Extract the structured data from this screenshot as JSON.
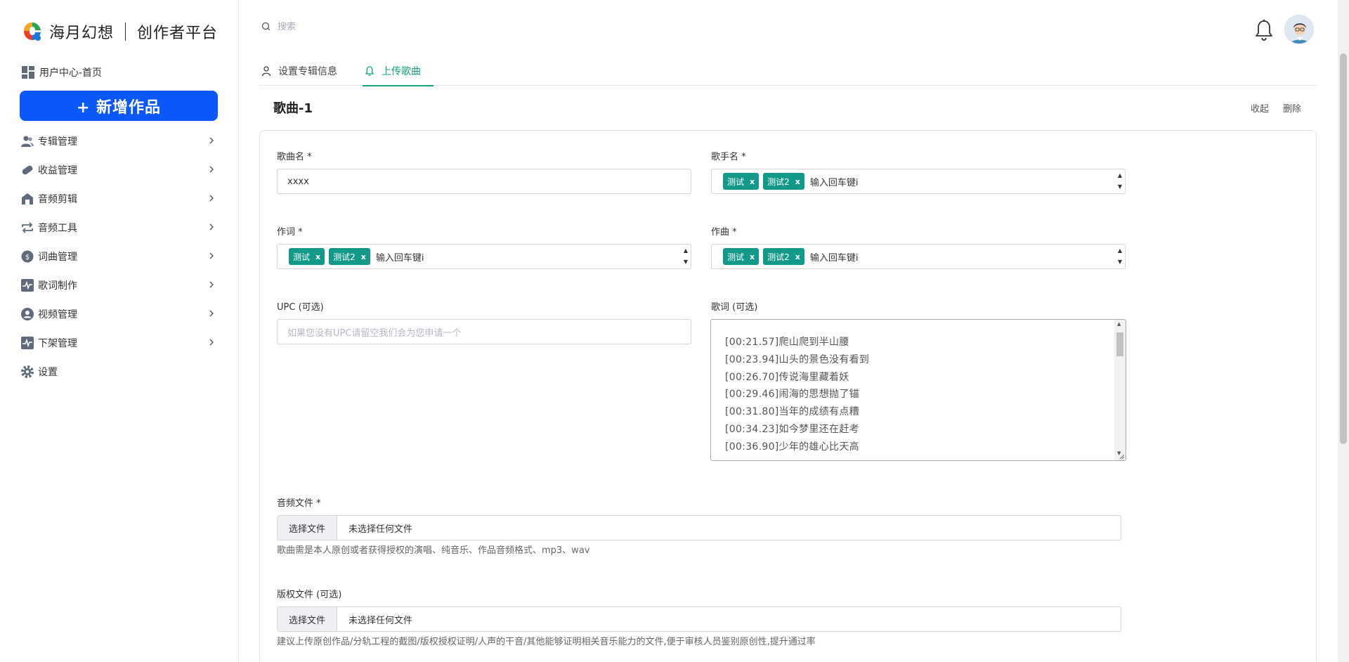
{
  "brand": {
    "name": "海月幻想",
    "subtitle": "创作者平台"
  },
  "sidebar": {
    "home_label": "用户中心-首页",
    "new_button_label": "+ 新增作品",
    "items": [
      {
        "label": "专辑管理",
        "icon": "users-icon"
      },
      {
        "label": "收益管理",
        "icon": "pill-icon"
      },
      {
        "label": "音频剪辑",
        "icon": "store-icon"
      },
      {
        "label": "音频工具",
        "icon": "repeat-icon"
      },
      {
        "label": "词曲管理",
        "icon": "dollar-circle-icon"
      },
      {
        "label": "歌词制作",
        "icon": "activity-icon"
      },
      {
        "label": "视频管理",
        "icon": "user-circle-icon"
      },
      {
        "label": "下架管理",
        "icon": "activity-icon"
      },
      {
        "label": "设置",
        "icon": "gear-icon"
      }
    ]
  },
  "header": {
    "search_placeholder": "搜索"
  },
  "tabs": [
    {
      "label": "设置专辑信息",
      "active": false,
      "icon": "user-icon"
    },
    {
      "label": "上传歌曲",
      "active": true,
      "icon": "bell-icon"
    }
  ],
  "song": {
    "title": "歌曲-1",
    "collapse_label": "收起",
    "delete_label": "删除"
  },
  "form": {
    "song_name_label": "歌曲名 *",
    "song_name_value": "xxxx",
    "singer_label": "歌手名 *",
    "singer_tags": [
      "测试",
      "测试2"
    ],
    "singer_placeholder": "输入回车键i",
    "lyricist_label": "作词 *",
    "lyricist_tags": [
      "测试",
      "测试2"
    ],
    "lyricist_placeholder": "输入回车键i",
    "composer_label": "作曲 *",
    "composer_tags": [
      "测试",
      "测试2"
    ],
    "composer_placeholder": "输入回车键i",
    "upc_label": "UPC (可选)",
    "upc_placeholder": "如果您没有UPC请留空我们会为您申请一个",
    "lyrics_label": "歌词 (可选)",
    "lyrics_lines": [
      "[00:21.57]爬山爬到半山腰",
      "[00:23.94]山头的景色没有看到",
      "[00:26.70]传说海里藏着妖",
      "[00:29.46]闹海的思想抛了锚",
      "[00:31.80]当年的成绩有点糟",
      "[00:34.23]如今梦里还在赶考",
      "[00:36.90]少年的雄心比天高"
    ],
    "audio_label": "音频文件 *",
    "audio_button": "选择文件",
    "audio_file": "未选择任何文件",
    "audio_hint": "歌曲需是本人原创或者获得授权的演唱、纯音乐、作品音频格式、mp3、wav",
    "copyright_label": "版权文件 (可选)",
    "copyright_button": "选择文件",
    "copyright_file": "未选择任何文件",
    "copyright_hint": "建议上传原创作品/分轨工程的截图/版权授权证明/人声的干音/其他能够证明相关音乐能力的文件,便于审核人员鉴别原创性,提升通过率"
  },
  "colors": {
    "primary_blue": "#0b57f7",
    "accent_green": "#14a37f",
    "tag_teal": "#12998a"
  }
}
